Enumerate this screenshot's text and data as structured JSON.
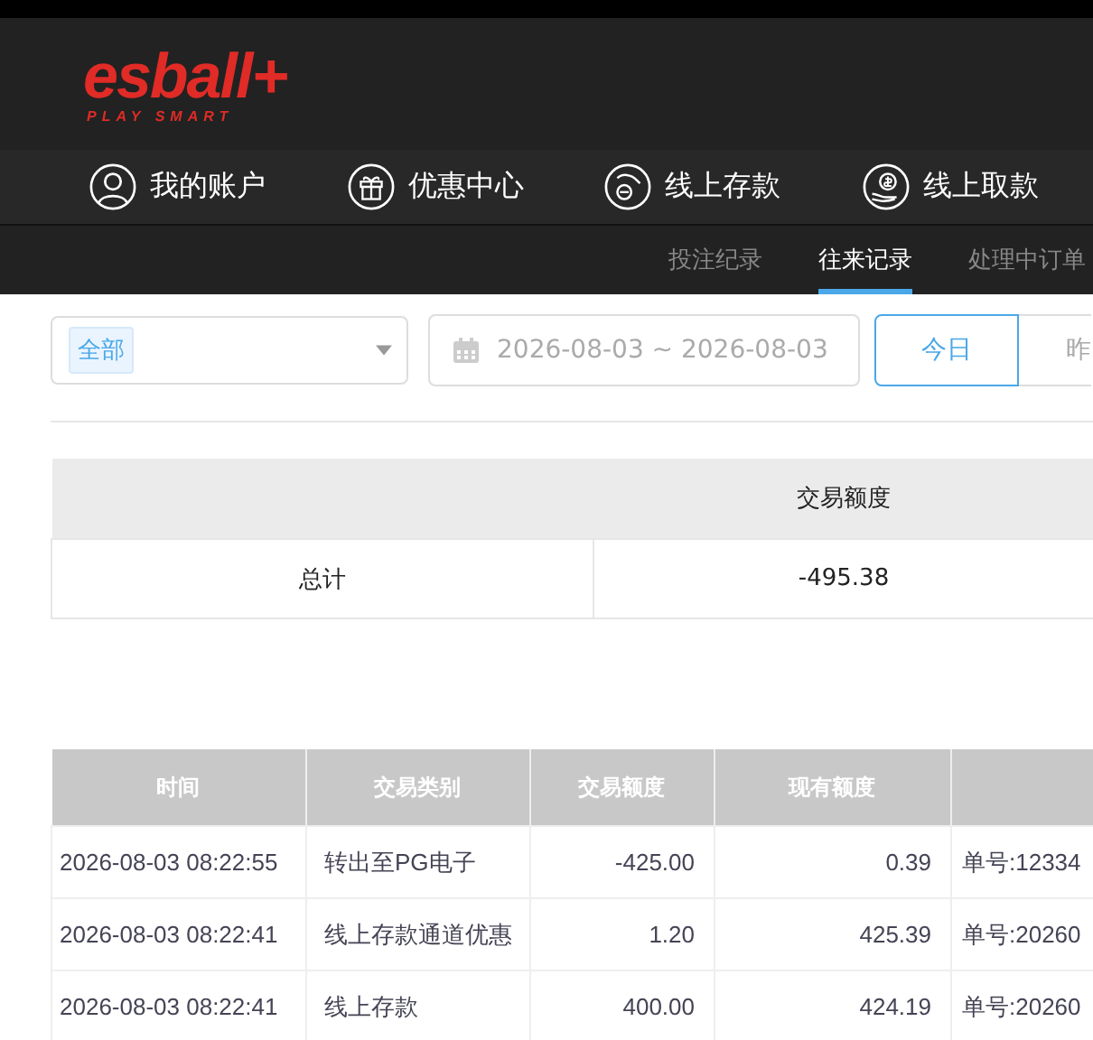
{
  "logo": {
    "name": "esball+",
    "tagline": "PLAY SMART"
  },
  "nav": [
    {
      "label": "我的账户"
    },
    {
      "label": "优惠中心"
    },
    {
      "label": "线上存款"
    },
    {
      "label": "线上取款"
    }
  ],
  "subtabs": [
    {
      "label": "投注纪录",
      "selected": false
    },
    {
      "label": "往来记录",
      "selected": true
    },
    {
      "label": "处理中订单",
      "selected": false
    }
  ],
  "filters": {
    "category_tag": "全部",
    "date_range": "2026-08-03 ~ 2026-08-03",
    "quick_ranges": [
      {
        "label": "今日",
        "selected": true
      },
      {
        "label": "昨",
        "selected": false
      }
    ]
  },
  "summary": {
    "columns": [
      "",
      "交易额度"
    ],
    "rows": [
      [
        "总计",
        "-495.38"
      ]
    ]
  },
  "table": {
    "columns": [
      "时间",
      "交易类别",
      "交易额度",
      "现有额度",
      ""
    ],
    "rows": [
      [
        "2026-08-03 08:22:55",
        "转出至PG电子",
        "-425.00",
        "0.39",
        "单号:12334"
      ],
      [
        "2026-08-03 08:22:41",
        "线上存款通道优惠",
        "1.20",
        "425.39",
        "单号:20260"
      ],
      [
        "2026-08-03 08:22:41",
        "线上存款",
        "400.00",
        "424.19",
        "单号:20260"
      ]
    ]
  }
}
